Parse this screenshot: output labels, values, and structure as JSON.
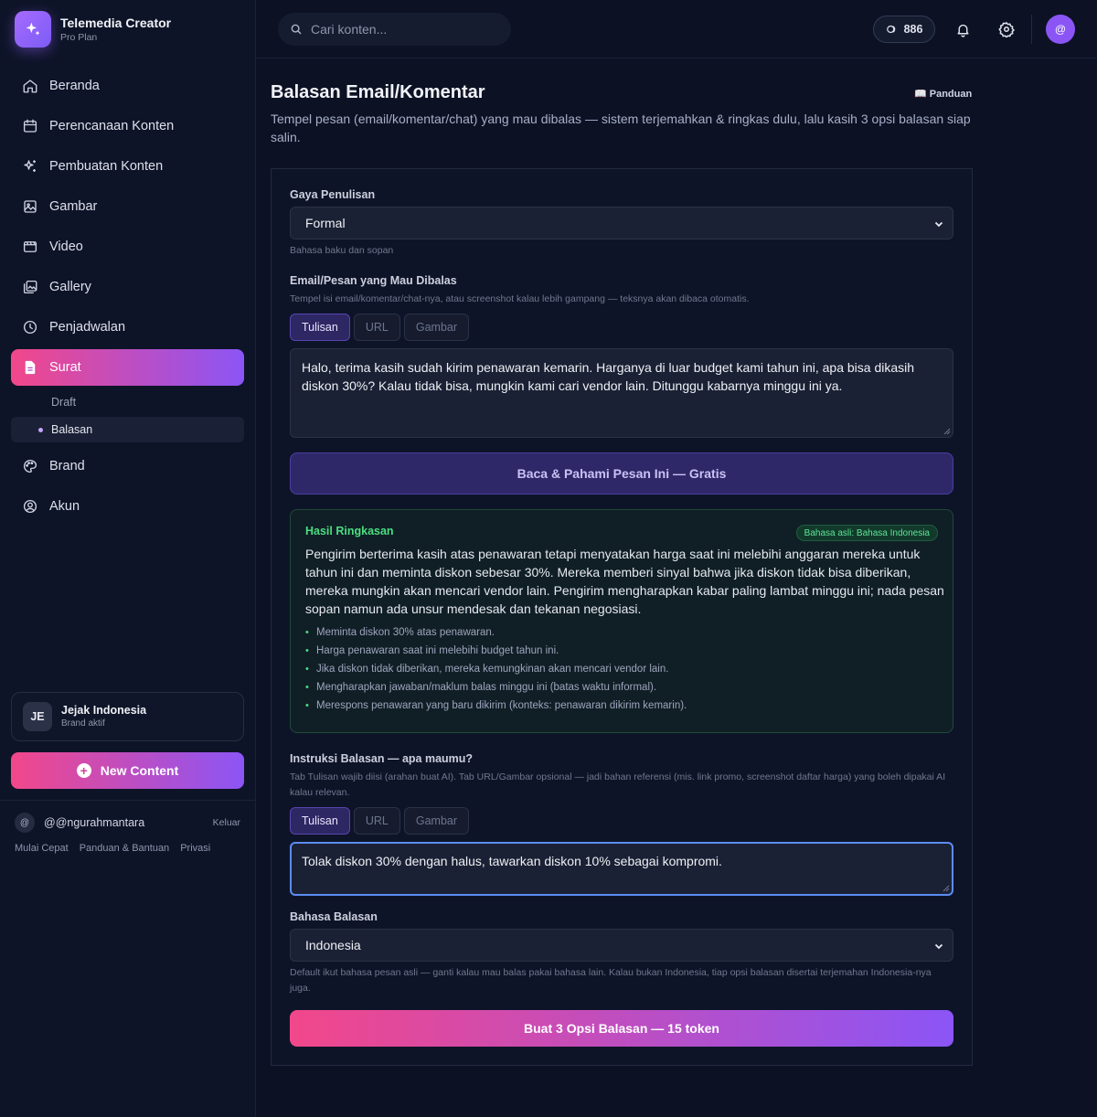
{
  "app": {
    "name": "Telemedia Creator",
    "plan": "Pro Plan"
  },
  "sidebar": {
    "items": [
      {
        "label": "Beranda",
        "icon": "home-icon"
      },
      {
        "label": "Perencanaan Konten",
        "icon": "calendar-icon"
      },
      {
        "label": "Pembuatan Konten",
        "icon": "sparkles-icon"
      },
      {
        "label": "Gambar",
        "icon": "image-icon"
      },
      {
        "label": "Video",
        "icon": "video-icon"
      },
      {
        "label": "Gallery",
        "icon": "gallery-icon"
      },
      {
        "label": "Penjadwalan",
        "icon": "clock-icon"
      },
      {
        "label": "Surat",
        "icon": "document-icon",
        "active": true
      },
      {
        "label": "Brand",
        "icon": "palette-icon"
      },
      {
        "label": "Akun",
        "icon": "user-circle-icon"
      }
    ],
    "sub_items": [
      {
        "label": "Draft"
      },
      {
        "label": "Balasan",
        "selected": true
      }
    ],
    "brand": {
      "initials": "JE",
      "name": "Jejak Indonesia",
      "status": "Brand aktif"
    },
    "new_content_label": "New Content",
    "user": {
      "avatar": "@",
      "name": "@@ngurahmantara",
      "logout_label": "Keluar"
    },
    "footer_links": [
      "Mulai Cepat",
      "Panduan & Bantuan",
      "Privasi"
    ]
  },
  "topbar": {
    "search_placeholder": "Cari konten...",
    "tokens": "886",
    "profile_initial": "@"
  },
  "page": {
    "title": "Balasan Email/Komentar",
    "guide_label": "📖 Panduan",
    "description": "Tempel pesan (email/komentar/chat) yang mau dibalas — sistem terjemahkan & ringkas dulu, lalu kasih 3 opsi balasan siap salin."
  },
  "form": {
    "style": {
      "label": "Gaya Penulisan",
      "value": "Formal",
      "hint": "Bahasa baku dan sopan"
    },
    "message": {
      "label": "Email/Pesan yang Mau Dibalas",
      "hint": "Tempel isi email/komentar/chat-nya, atau screenshot kalau lebih gampang — teksnya akan dibaca otomatis.",
      "tabs": [
        "Tulisan",
        "URL",
        "Gambar"
      ],
      "active_tab": "Tulisan",
      "value": "Halo, terima kasih sudah kirim penawaran kemarin. Harganya di luar budget kami tahun ini, apa bisa dikasih diskon 30%? Kalau tidak bisa, mungkin kami cari vendor lain. Ditunggu kabarnya minggu ini ya."
    },
    "read_button_label": "Baca & Pahami Pesan Ini — Gratis",
    "summary": {
      "title": "Hasil Ringkasan",
      "language_badge": "Bahasa asli: Bahasa Indonesia",
      "text": "Pengirim berterima kasih atas penawaran tetapi menyatakan harga saat ini melebihi anggaran mereka untuk tahun ini dan meminta diskon sebesar 30%. Mereka memberi sinyal bahwa jika diskon tidak bisa diberikan, mereka mungkin akan mencari vendor lain. Pengirim mengharapkan kabar paling lambat minggu ini; nada pesan sopan namun ada unsur mendesak dan tekanan negosiasi.",
      "points": [
        "Meminta diskon 30% atas penawaran.",
        "Harga penawaran saat ini melebihi budget tahun ini.",
        "Jika diskon tidak diberikan, mereka kemungkinan akan mencari vendor lain.",
        "Mengharapkan jawaban/maklum balas minggu ini (batas waktu informal).",
        "Merespons penawaran yang baru dikirim (konteks: penawaran dikirim kemarin)."
      ],
      "accent_color": "#4ade80"
    },
    "instruction": {
      "label": "Instruksi Balasan — apa maumu?",
      "hint": "Tab Tulisan wajib diisi (arahan buat AI). Tab URL/Gambar opsional — jadi bahan referensi (mis. link promo, screenshot daftar harga) yang boleh dipakai AI kalau relevan.",
      "tabs": [
        "Tulisan",
        "URL",
        "Gambar"
      ],
      "active_tab": "Tulisan",
      "value": "Tolak diskon 30% dengan halus, tawarkan diskon 10% sebagai kompromi."
    },
    "reply_language": {
      "label": "Bahasa Balasan",
      "value": "Indonesia",
      "hint": "Default ikut bahasa pesan asli — ganti kalau mau balas pakai bahasa lain. Kalau bukan Indonesia, tiap opsi balasan disertai terjemahan Indonesia-nya juga."
    },
    "submit_label": "Buat 3 Opsi Balasan — 15 token"
  },
  "colors": {
    "background": "#0c1224",
    "accent_gradient_start": "#f2478a",
    "accent_gradient_end": "#8b55f6",
    "brand_purple": "#8b55f6"
  }
}
